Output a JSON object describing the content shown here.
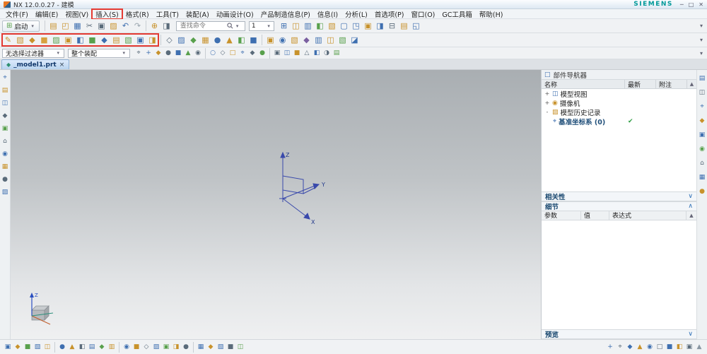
{
  "window": {
    "badge": "NX",
    "title": "NX 12.0.0.27 - 建模",
    "brand": "SIEMENS",
    "min": "─",
    "max": "□",
    "close": "✕"
  },
  "ui": {
    "caret": "▾",
    "accent_red": "#e43a32",
    "brand_teal": "#009999",
    "check_green": "#2e9e44"
  },
  "menubar": {
    "items": [
      {
        "label": "文件(F)"
      },
      {
        "label": "编辑(E)"
      },
      {
        "label": "视图(V)"
      },
      {
        "label": "插入(S)",
        "highlighted": true
      },
      {
        "label": "格式(R)"
      },
      {
        "label": "工具(T)"
      },
      {
        "label": "装配(A)"
      },
      {
        "label": "动画设计(O)"
      },
      {
        "label": "产品制造信息(P)"
      },
      {
        "label": "信息(I)"
      },
      {
        "label": "分析(L)"
      },
      {
        "label": "首选项(P)"
      },
      {
        "label": "窗口(O)"
      },
      {
        "label": "GC工具箱"
      },
      {
        "label": "帮助(H)"
      }
    ]
  },
  "toolbar_top": {
    "start": "启动",
    "search_placeholder": "查找命令",
    "zoom": "1"
  },
  "selection": {
    "filter": "无选择过滤器",
    "scope": "整个装配"
  },
  "tabs": {
    "icon": "◆",
    "label": "_model1.prt",
    "close": "×"
  },
  "canvas": {
    "axis_z": "Z",
    "axis_y": "Y",
    "axis_x": "X",
    "triad_z": "Z"
  },
  "navigator": {
    "icon": "□",
    "title": "部件导航器",
    "scroll_up": "▲",
    "cols": {
      "name": "名称",
      "latest": "最新",
      "note": "附注"
    },
    "tree": [
      {
        "exp": "+",
        "ic": "◫",
        "label": "模型视图",
        "check": ""
      },
      {
        "exp": "+",
        "ic": "◉",
        "label": "摄像机",
        "check": ""
      },
      {
        "exp": "-",
        "ic": "▨",
        "label": "模型历史记录",
        "check": ""
      },
      {
        "exp": "",
        "ic": "⌖",
        "label": "基准坐标系 (0)",
        "check": "✔"
      }
    ],
    "sections": {
      "dependencies": "相关性",
      "details": "细节",
      "preview": "预览",
      "chev_down": "∨",
      "chev_up": "∧"
    },
    "detail_cols": {
      "param": "参数",
      "value": "值",
      "expr": "表达式",
      "caret": "▲"
    }
  },
  "icons": {
    "row1_left": [
      {
        "n": "new-icon",
        "g": "▤",
        "c": "#c8922b"
      },
      {
        "n": "open-icon",
        "g": "◰",
        "c": "#c8922b"
      },
      {
        "n": "save-icon",
        "g": "▦",
        "c": "#3e6fb0"
      },
      {
        "n": "cut-icon",
        "g": "✂",
        "c": "#5a6b7a"
      },
      {
        "n": "copy-icon",
        "g": "▣",
        "c": "#5a6b7a"
      },
      {
        "n": "paste-icon",
        "g": "▨",
        "c": "#c8922b"
      },
      {
        "n": "undo-icon",
        "g": "↶",
        "c": "#3e6fb0"
      },
      {
        "n": "redo-icon",
        "g": "↷",
        "c": "#9aa5ae"
      },
      {
        "sep": true
      },
      {
        "n": "repeat-command-icon",
        "g": "⊕",
        "c": "#c8922b"
      },
      {
        "n": "touch-mode-icon",
        "g": "◨",
        "c": "#5a6b7a"
      }
    ],
    "row1_right": [
      {
        "g": "⊞",
        "c": "#3e6fb0"
      },
      {
        "g": "◫",
        "c": "#c8922b"
      },
      {
        "g": "▥",
        "c": "#3e6fb0"
      },
      {
        "g": "◧",
        "c": "#58a04c"
      },
      {
        "g": "▧",
        "c": "#c8922b"
      },
      {
        "g": "▢",
        "c": "#3e6fb0"
      },
      {
        "g": "◳",
        "c": "#3e6fb0"
      },
      {
        "g": "▣",
        "c": "#c8922b"
      },
      {
        "g": "◨",
        "c": "#3e6fb0"
      },
      {
        "g": "⊟",
        "c": "#5a6b7a"
      },
      {
        "g": "▤",
        "c": "#c8922b"
      },
      {
        "g": "◱",
        "c": "#3e6fb0"
      }
    ],
    "row2_boxed": [
      {
        "n": "sketch-icon",
        "g": "✎",
        "c": "#c8922b"
      },
      {
        "g": "▧",
        "c": "#c8922b"
      },
      {
        "g": "◆",
        "c": "#c8922b"
      },
      {
        "g": "■",
        "c": "#d7a13f"
      },
      {
        "g": "▨",
        "c": "#58a04c"
      },
      {
        "g": "▣",
        "c": "#c8922b"
      },
      {
        "g": "◧",
        "c": "#3e6fb0"
      },
      {
        "g": "■",
        "c": "#58a04c"
      },
      {
        "g": "◆",
        "c": "#3e6fb0"
      },
      {
        "g": "▤",
        "c": "#c8922b"
      },
      {
        "g": "▧",
        "c": "#58a04c"
      },
      {
        "g": "▣",
        "c": "#3e6fb0"
      },
      {
        "g": "◨",
        "c": "#c8922b"
      }
    ],
    "row2_rest": [
      {
        "sep": true
      },
      {
        "g": "◇",
        "c": "#5a6b7a"
      },
      {
        "g": "▨",
        "c": "#3e6fb0"
      },
      {
        "g": "◆",
        "c": "#58a04c"
      },
      {
        "g": "▦",
        "c": "#c8922b"
      },
      {
        "g": "●",
        "c": "#3e6fb0"
      },
      {
        "g": "▲",
        "c": "#c8922b"
      },
      {
        "g": "◧",
        "c": "#58a04c"
      },
      {
        "g": "■",
        "c": "#3e6fb0"
      },
      {
        "sep": true
      },
      {
        "g": "▣",
        "c": "#c8922b"
      },
      {
        "g": "◉",
        "c": "#3e6fb0"
      },
      {
        "g": "▧",
        "c": "#c8922b"
      },
      {
        "g": "◆",
        "c": "#7a5fa0"
      },
      {
        "g": "▥",
        "c": "#3e6fb0"
      },
      {
        "g": "◫",
        "c": "#c8922b"
      },
      {
        "g": "▧",
        "c": "#58a04c"
      },
      {
        "g": "◪",
        "c": "#3e6fb0"
      }
    ],
    "row3": [
      {
        "g": "⌖",
        "c": "#5a6b7a"
      },
      {
        "g": "+",
        "c": "#3e6fb0"
      },
      {
        "g": "◆",
        "c": "#c8922b"
      },
      {
        "g": "●",
        "c": "#5a6b7a"
      },
      {
        "g": "■",
        "c": "#3e6fb0"
      },
      {
        "g": "▲",
        "c": "#58a04c"
      },
      {
        "g": "◉",
        "c": "#5a6b7a"
      },
      {
        "sep": true
      },
      {
        "g": "○",
        "c": "#3e6fb0"
      },
      {
        "g": "◇",
        "c": "#5a6b7a"
      },
      {
        "g": "□",
        "c": "#c8922b"
      },
      {
        "g": "⌖",
        "c": "#3e6fb0"
      },
      {
        "g": "◆",
        "c": "#5a6b7a"
      },
      {
        "g": "●",
        "c": "#58a04c"
      },
      {
        "sep": true
      },
      {
        "g": "▣",
        "c": "#5a6b7a"
      },
      {
        "g": "◫",
        "c": "#3e6fb0"
      },
      {
        "g": "■",
        "c": "#c8922b"
      },
      {
        "g": "△",
        "c": "#5a6b7a"
      },
      {
        "g": "◧",
        "c": "#3e6fb0"
      },
      {
        "g": "◑",
        "c": "#5a6b7a"
      },
      {
        "g": "▤",
        "c": "#58a04c"
      }
    ],
    "left_bar": [
      {
        "g": "⌖",
        "c": "#3e6fb0"
      },
      {
        "g": "▤",
        "c": "#c8922b"
      },
      {
        "g": "◫",
        "c": "#3e6fb0"
      },
      {
        "g": "◆",
        "c": "#5a6b7a"
      },
      {
        "g": "▣",
        "c": "#58a04c"
      },
      {
        "g": "⌂",
        "c": "#5a6b7a"
      },
      {
        "g": "◉",
        "c": "#3e6fb0"
      },
      {
        "g": "▦",
        "c": "#c8922b"
      },
      {
        "g": "●",
        "c": "#5a6b7a"
      },
      {
        "g": "▨",
        "c": "#3e6fb0"
      }
    ],
    "right_bar": [
      {
        "g": "▤",
        "c": "#3e6fb0"
      },
      {
        "g": "◫",
        "c": "#5a6b7a"
      },
      {
        "g": "⌖",
        "c": "#3e6fb0"
      },
      {
        "g": "◆",
        "c": "#c8922b"
      },
      {
        "g": "▣",
        "c": "#3e6fb0"
      },
      {
        "g": "◉",
        "c": "#58a04c"
      },
      {
        "g": "⌂",
        "c": "#5a6b7a"
      },
      {
        "g": "▦",
        "c": "#3e6fb0"
      },
      {
        "g": "●",
        "c": "#c8922b"
      }
    ],
    "bottom_left": [
      {
        "g": "▣",
        "c": "#3e6fb0"
      },
      {
        "g": "◆",
        "c": "#c8922b"
      },
      {
        "g": "■",
        "c": "#58a04c"
      },
      {
        "g": "▧",
        "c": "#3e6fb0"
      },
      {
        "g": "◫",
        "c": "#c8922b"
      },
      {
        "sep": true
      },
      {
        "g": "●",
        "c": "#3e6fb0"
      },
      {
        "g": "▲",
        "c": "#c8922b"
      },
      {
        "g": "◧",
        "c": "#5a6b7a"
      },
      {
        "g": "▤",
        "c": "#3e6fb0"
      },
      {
        "g": "◆",
        "c": "#58a04c"
      },
      {
        "g": "▥",
        "c": "#c8922b"
      },
      {
        "sep": true
      },
      {
        "g": "◉",
        "c": "#3e6fb0"
      },
      {
        "g": "■",
        "c": "#c8922b"
      },
      {
        "g": "◇",
        "c": "#5a6b7a"
      },
      {
        "g": "▨",
        "c": "#3e6fb0"
      },
      {
        "g": "▣",
        "c": "#58a04c"
      },
      {
        "g": "◨",
        "c": "#c8922b"
      },
      {
        "g": "●",
        "c": "#5a6b7a"
      },
      {
        "sep": true
      },
      {
        "g": "▦",
        "c": "#3e6fb0"
      },
      {
        "g": "◆",
        "c": "#c8922b"
      },
      {
        "g": "▧",
        "c": "#3e6fb0"
      },
      {
        "g": "■",
        "c": "#5a6b7a"
      },
      {
        "g": "◫",
        "c": "#58a04c"
      }
    ],
    "bottom_right": [
      {
        "g": "+",
        "c": "#3e6fb0"
      },
      {
        "g": "⌖",
        "c": "#5a6b7a"
      },
      {
        "g": "◆",
        "c": "#3e6fb0"
      },
      {
        "g": "▲",
        "c": "#c8922b"
      },
      {
        "g": "◉",
        "c": "#3e6fb0"
      },
      {
        "g": "□",
        "c": "#5a6b7a"
      },
      {
        "g": "■",
        "c": "#3e6fb0"
      },
      {
        "g": "◧",
        "c": "#c8922b"
      },
      {
        "g": "▣",
        "c": "#5a6b7a"
      },
      {
        "g": "▲",
        "c": "#8a97a3"
      }
    ]
  }
}
